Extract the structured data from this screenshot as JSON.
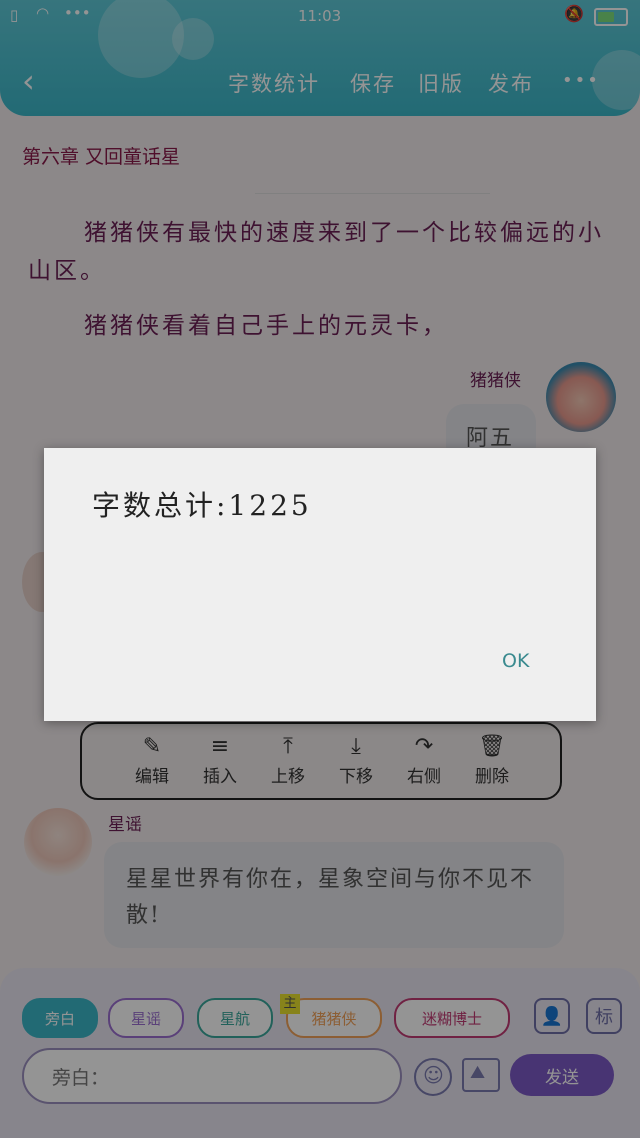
{
  "status": {
    "time": "11:03",
    "signal_icon": "wifi-icon",
    "dots": "•••",
    "mute_icon": "bell-off-icon"
  },
  "header": {
    "back_icon": "chevron-left-icon",
    "actions": [
      "字数统计",
      "保存",
      "旧版",
      "发布"
    ],
    "more": "•••"
  },
  "chapter_title": "第六章   又回童话星",
  "paragraphs": [
    "猪猪侠有最快的速度来到了一个比较偏远的小山区。",
    "猪猪侠看着自己手上的元灵卡，"
  ],
  "messages": [
    {
      "speaker": "猪猪侠",
      "text": "阿五"
    },
    {
      "speaker": "星谣",
      "text": "星星世界有你在，星象空间与你不见不散!"
    }
  ],
  "toolbar": [
    {
      "label": "编辑",
      "icon": "edit-icon",
      "glyph": "✎"
    },
    {
      "label": "插入",
      "icon": "insert-icon",
      "glyph": "≡"
    },
    {
      "label": "上移",
      "icon": "move-up-icon",
      "glyph": "⤒"
    },
    {
      "label": "下移",
      "icon": "move-down-icon",
      "glyph": "⤓"
    },
    {
      "label": "右侧",
      "icon": "redo-icon",
      "glyph": "↷"
    },
    {
      "label": "删除",
      "icon": "trash-icon",
      "glyph": "🗑"
    }
  ],
  "roles": [
    {
      "label": "旁白",
      "color": "#3cb7c9",
      "selected": true
    },
    {
      "label": "星谣",
      "color": "#9b6fd1"
    },
    {
      "label": "星航",
      "color": "#3aa79b"
    },
    {
      "label": "猪猪侠",
      "color": "#f2a25a",
      "badge": "主"
    },
    {
      "label": "迷糊博士",
      "color": "#c23b74"
    }
  ],
  "role_buttons": {
    "person_icon": "person-icon",
    "tag": "标"
  },
  "input": {
    "placeholder": "旁白："
  },
  "send_label": "发送",
  "dialog": {
    "message": "字数总计:1225",
    "ok_label": "OK"
  }
}
